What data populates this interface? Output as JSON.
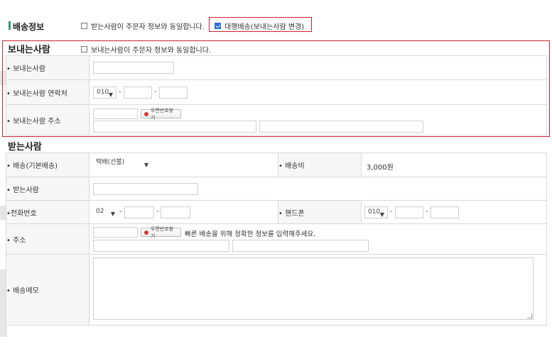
{
  "delivery": {
    "title": "배송정보",
    "same_as_orderer": "받는사람이 주문자 정보와 동일합니다.",
    "proxy_delivery": "대행배송(보내는사람 변경)"
  },
  "sender": {
    "title": "보내는사람",
    "same_as_orderer": "보내는사람이 주문자 정보와 동일합니다.",
    "labels": {
      "name": "• 보내는사람",
      "phone": "• 보내는사람 연락처",
      "address": "• 보내는사람 주소"
    },
    "phone_prefix": "010",
    "zip_button": "우편번호찾기"
  },
  "receiver": {
    "title": "받는사람",
    "labels": {
      "shipping_method": "• 배송(기본배송)",
      "shipping_fee": "• 배송비",
      "name": "• 받는사람",
      "tel": "•전화번호",
      "mobile": "• 핸드폰",
      "address": "• 주소",
      "memo": "• 배송메모"
    },
    "shipping_method_value": "택배(선불)",
    "shipping_fee_value": "3,000원",
    "tel_prefix": "02",
    "mobile_prefix": "010",
    "zip_button": "우편번호찾기",
    "address_hint": "빠른 배송을 위해 정확한 정보를 입력해주세요."
  },
  "icons": {
    "dropdown": "chevron-down-icon",
    "zip": "location-dot-icon"
  },
  "colors": {
    "accent_green": "#2f9e6a",
    "highlight_red": "#d0202e",
    "checkbox_blue": "#2a6fd6"
  }
}
